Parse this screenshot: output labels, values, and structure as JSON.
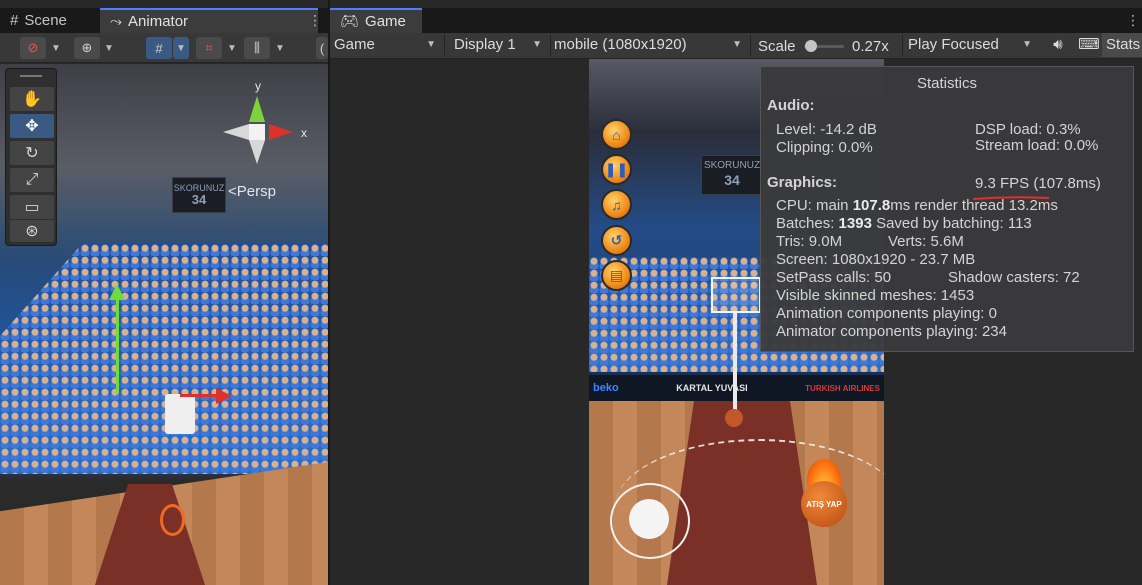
{
  "scene_panel": {
    "tabs": [
      {
        "label": "Scene",
        "icon": "grid-icon"
      },
      {
        "label": "Animator",
        "icon": "animator-icon"
      }
    ],
    "persp_label": "<Persp",
    "gizmo_axes": {
      "y": "y",
      "x": "x"
    },
    "scoreboard_text": "SKORUNUZ",
    "scoreboard_value": "34"
  },
  "game_panel": {
    "tab_label": "Game",
    "toolbar": {
      "game_dropdown": "Game",
      "display_dropdown": "Display 1",
      "resolution_dropdown": "mobile (1080x1920)",
      "scale_label": "Scale",
      "scale_value": "0.27x",
      "play_mode_dropdown": "Play Focused",
      "stats_button": "Stats"
    },
    "game_view": {
      "scoreboard_text": "SKORUNUZ",
      "scoreboard_value": "34",
      "banner_left": "beko",
      "banner_center": "KARTAL YUVASI",
      "banner_right": "TURKISH AIRLINES",
      "shoot_button": "ATIŞ YAP"
    },
    "statistics": {
      "title": "Statistics",
      "audio_header": "Audio:",
      "level": "Level: -14.2 dB",
      "clipping": "Clipping: 0.0%",
      "dsp_load": "DSP load: 0.3%",
      "stream_load": "Stream load: 0.0%",
      "graphics_header": "Graphics:",
      "fps": "9.3 FPS (107.8ms)",
      "cpu_main_label": "CPU: main ",
      "cpu_main_value": "107.8",
      "cpu_main_rest": "ms  render thread 13.2ms",
      "batches_label": "Batches: ",
      "batches_value": "1393",
      "batches_rest": "  Saved by batching: 113",
      "tris": "Tris: 9.0M",
      "verts": "Verts: 5.6M",
      "screen": "Screen: 1080x1920 - 23.7 MB",
      "setpass": "SetPass calls: 50",
      "shadow_casters": "Shadow casters: 72",
      "skinned_meshes": "Visible skinned meshes: 1453",
      "animation_components": "Animation components playing: 0",
      "animator_components": "Animator components playing: 234"
    }
  },
  "colors": {
    "accent": "#4c7efe",
    "fps_underline": "#e0302a",
    "panel_bg": "#282828",
    "toolbar_bg": "#383838"
  }
}
